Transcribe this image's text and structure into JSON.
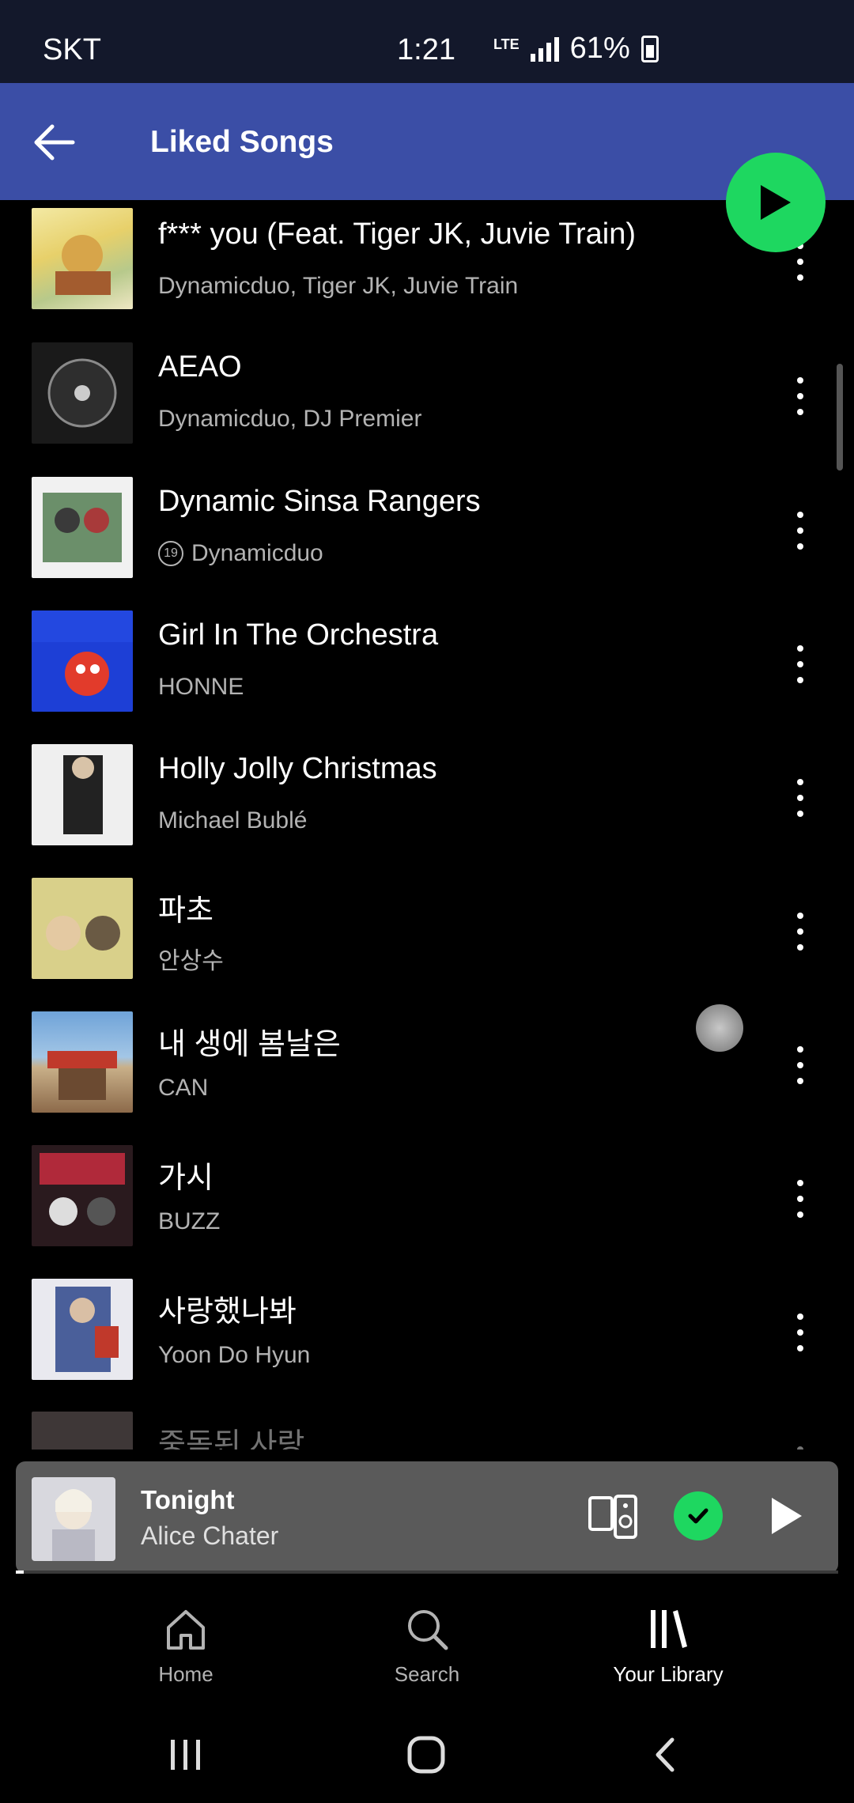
{
  "status_bar": {
    "carrier": "SKT",
    "time": "1:21",
    "network": "LTE",
    "battery": "61%"
  },
  "header": {
    "title": "Liked Songs",
    "back_icon": "arrow-left-icon",
    "play_icon": "play-icon"
  },
  "colors": {
    "accent": "#1ed760",
    "header_bg": "#3b4ea6",
    "background": "#000000",
    "mini_player_bg": "#5a5a5a"
  },
  "songs": [
    {
      "title": "f*** you (Feat. Tiger JK, Juvie Train)",
      "artist": "Dynamicduo, Tiger JK, Juvie Train",
      "explicit": false
    },
    {
      "title": "AEAO",
      "artist": "Dynamicduo, DJ Premier",
      "explicit": false
    },
    {
      "title": "Dynamic Sinsa Rangers",
      "artist": "Dynamicduo",
      "explicit": true,
      "explicit_label": "19"
    },
    {
      "title": "Girl In The Orchestra",
      "artist": "HONNE",
      "explicit": false
    },
    {
      "title": "Holly Jolly Christmas",
      "artist": "Michael Bublé",
      "explicit": false
    },
    {
      "title": "파초",
      "artist": "안상수",
      "explicit": false
    },
    {
      "title": "내 생에 봄날은",
      "artist": "CAN",
      "explicit": false
    },
    {
      "title": "가시",
      "artist": "BUZZ",
      "explicit": false
    },
    {
      "title": "사랑했나봐",
      "artist": "Yoon Do Hyun",
      "explicit": false
    },
    {
      "title": "중독된 사랑",
      "artist": "",
      "explicit": false
    }
  ],
  "now_playing": {
    "title": "Tonight",
    "artist": "Alice Chater",
    "progress": 0.01
  },
  "bottom_nav": [
    {
      "label": "Home",
      "icon": "home-icon",
      "active": false
    },
    {
      "label": "Search",
      "icon": "search-icon",
      "active": false
    },
    {
      "label": "Your Library",
      "icon": "library-icon",
      "active": true
    }
  ]
}
